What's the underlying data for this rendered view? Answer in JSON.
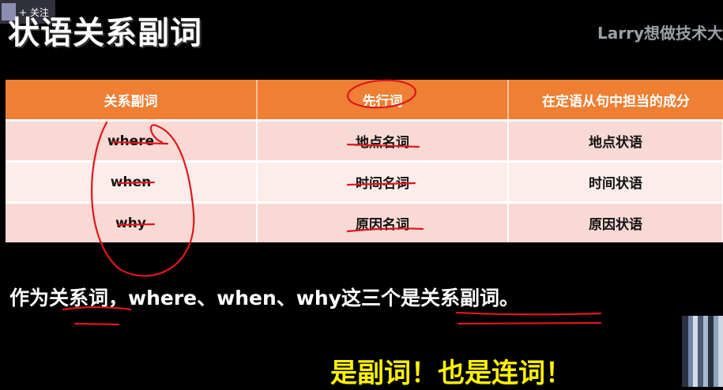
{
  "header": {
    "title": "状语关系副词",
    "follow_label": "+ 关注",
    "watermark": "Larry想做技术大"
  },
  "table": {
    "columns": [
      "关系副词",
      "先行词",
      "在定语从句中担当的成分"
    ],
    "rows": [
      [
        "where",
        "地点名词",
        "地点状语"
      ],
      [
        "when",
        "时间名词",
        "时间状语"
      ],
      [
        "why",
        "原因名词",
        "原因状语"
      ]
    ]
  },
  "sentence": "作为关系词，where、when、why这三个是关系副词。",
  "slogan": "是副词！也是连词！",
  "colors": {
    "header_bg": "#ee7f33",
    "row_odd": "#f8d9d4",
    "row_even": "#fcedea",
    "annotation_red": "#e0161b",
    "slogan_yellow": "#fff200"
  }
}
